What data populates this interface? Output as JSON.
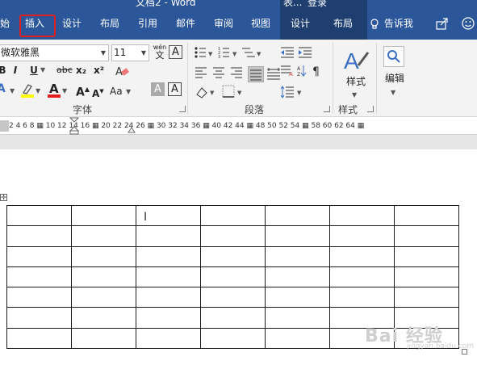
{
  "window": {
    "title": "文档2 - Word",
    "context_label": "表...",
    "login": "登录"
  },
  "tabs": [
    {
      "label": "始",
      "active": false
    },
    {
      "label": "插入",
      "highlighted": true
    },
    {
      "label": "设计"
    },
    {
      "label": "布局"
    },
    {
      "label": "引用"
    },
    {
      "label": "邮件"
    },
    {
      "label": "审阅"
    },
    {
      "label": "视图"
    }
  ],
  "context_tabs": [
    {
      "label": "设计"
    },
    {
      "label": "布局"
    }
  ],
  "tell_me": "告诉我",
  "font": {
    "name": "微软雅黑",
    "size": "11",
    "pinyin_top": "wén",
    "pinyin_bottom": "文",
    "border_char": "A",
    "bold": "B",
    "italic": "I",
    "underline": "U",
    "strike": "abc",
    "subscript": "x₂",
    "superscript": "x²",
    "grow": "A",
    "shrink": "A",
    "aa": "Aa",
    "font_color_letter": "A",
    "highlight_color": "#ffff00",
    "font_color": "#e02020",
    "char_shading": "A",
    "char_border": "A",
    "group_label": "字体"
  },
  "paragraph": {
    "group_label": "段落"
  },
  "styles": {
    "button_label": "样式",
    "group_label": "样式"
  },
  "editing": {
    "button_label": "编辑"
  },
  "ruler": {
    "numbers": "2  4  6  8 ▦ 10 12 14 16 ▦ 20 22 24 26 ▦ 30 32 34 36 ▦ 40 42 44 ▦ 48 50 52 54 ▦ 58 60 62 64 ▦"
  },
  "table": {
    "rows": 7,
    "cols": 7
  },
  "watermark": {
    "text": "Bai 经验",
    "sub": "jingyan.baidu.com"
  },
  "colors": {
    "accent": "#2b579a",
    "context_accent": "#1e3f70",
    "highlight_box": "#e02020"
  }
}
